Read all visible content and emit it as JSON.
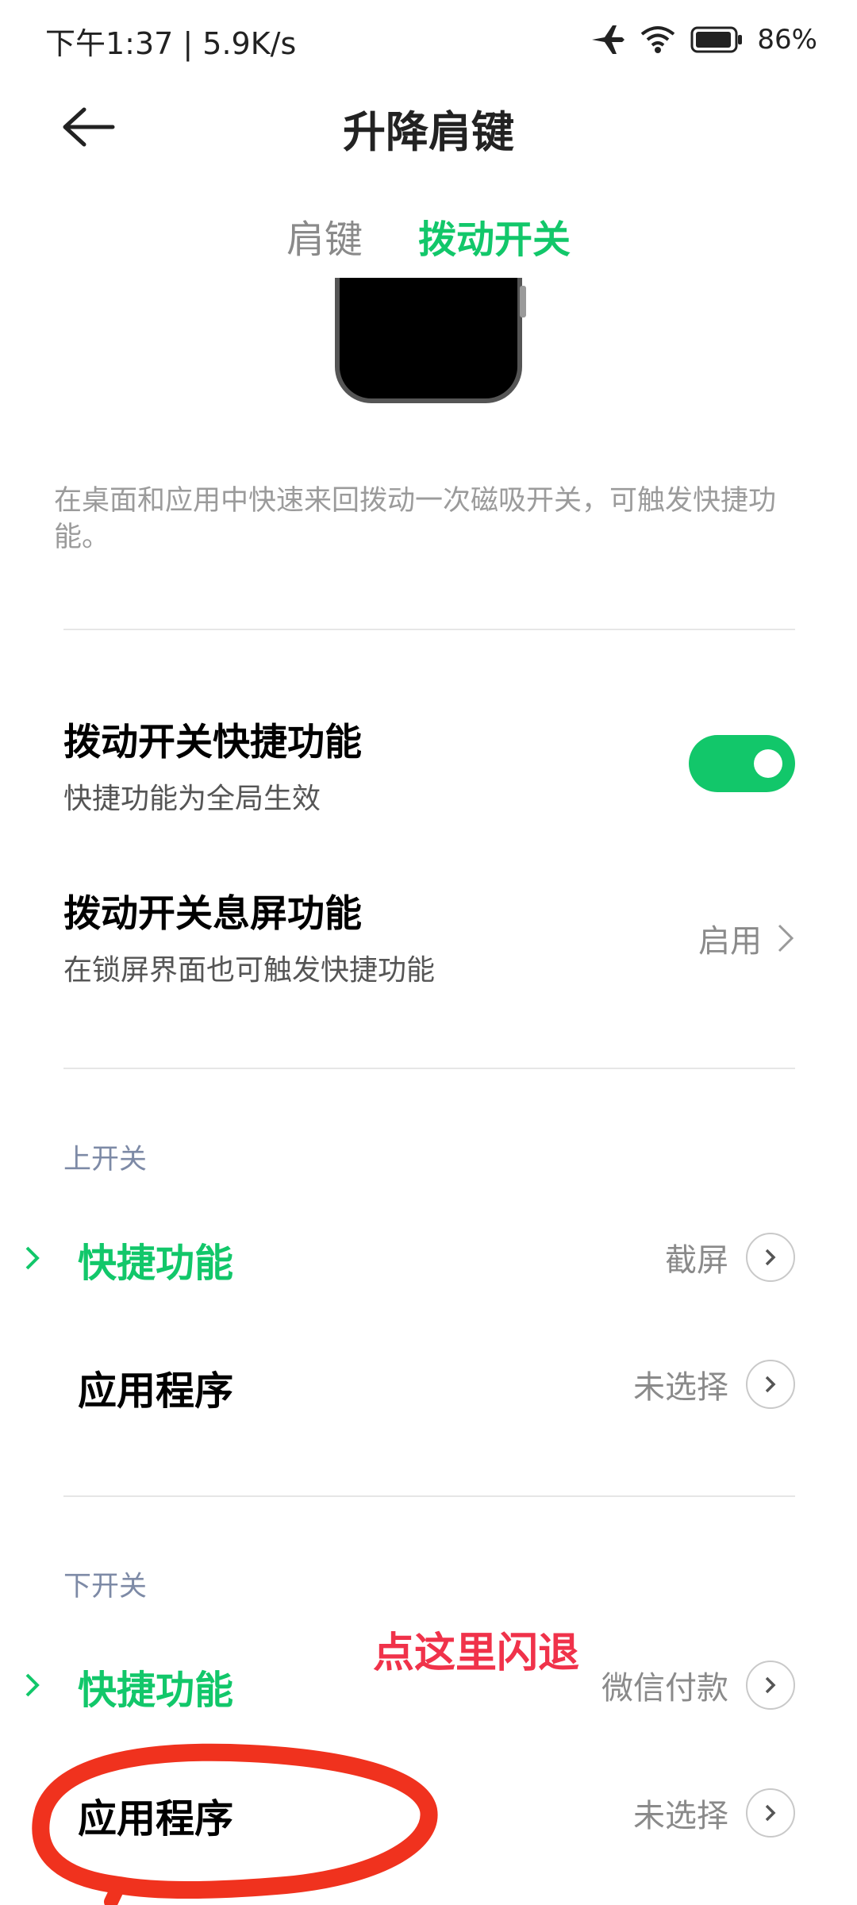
{
  "status": {
    "time": "下午1:37 | 5.9K/s",
    "battery": "86%"
  },
  "header": {
    "title": "升降肩键"
  },
  "tabs": [
    {
      "label": "肩键",
      "active": false
    },
    {
      "label": "拨动开关",
      "active": true
    }
  ],
  "description": "在桌面和应用中快速来回拨动一次磁吸开关，可触发快捷功能。",
  "settings": {
    "shortcut": {
      "title": "拨动开关快捷功能",
      "subtitle": "快捷功能为全局生效",
      "enabled": true
    },
    "screen_off": {
      "title": "拨动开关息屏功能",
      "subtitle": "在锁屏界面也可触发快捷功能",
      "value": "启用"
    }
  },
  "upper_switch": {
    "label": "上开关",
    "items": [
      {
        "label": "快捷功能",
        "value": "截屏"
      },
      {
        "label": "应用程序",
        "value": "未选择"
      }
    ]
  },
  "lower_switch": {
    "label": "下开关",
    "items": [
      {
        "label": "快捷功能",
        "value": "微信付款"
      },
      {
        "label": "应用程序",
        "value": "未选择"
      }
    ]
  },
  "annotation": {
    "text": "点这里闪退"
  },
  "colors": {
    "accent": "#12c76a",
    "annotation": "#f0324a"
  }
}
